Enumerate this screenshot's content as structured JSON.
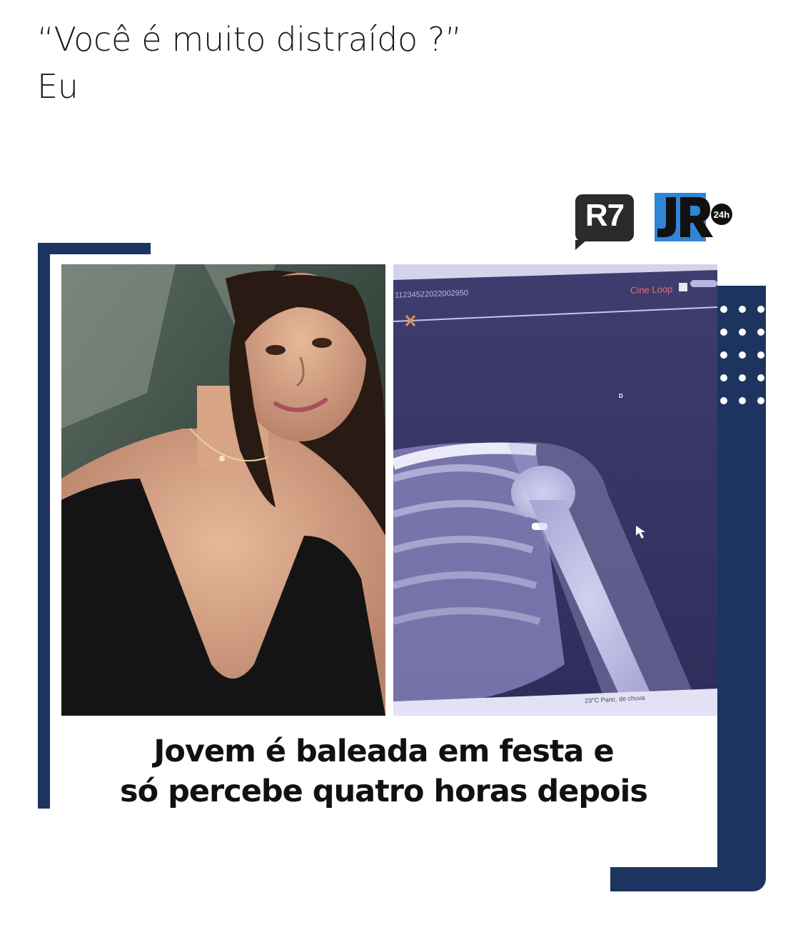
{
  "tweet": {
    "line1": "“Você é muito distraído ?”",
    "line2": "Eu"
  },
  "logos": {
    "r7": "R7",
    "jr": "JR",
    "jr_badge": "24h"
  },
  "xray": {
    "id_text": "11234522022002950",
    "cine_loop": "Cine Loop",
    "marker": "D",
    "taskbar_text": "23°C  Panc. de chuva"
  },
  "headline": {
    "line1": "Jovem é baleada em festa e",
    "line2": "só percebe quatro horas depois"
  },
  "colors": {
    "frame": "#1d3461",
    "xray_bg": "#c9c6e6"
  }
}
